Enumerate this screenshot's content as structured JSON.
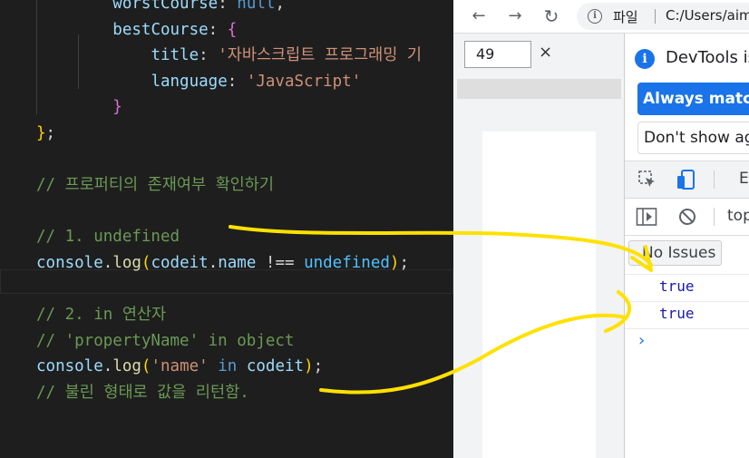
{
  "editor": {
    "lines": [
      [
        {
          "t": "        ",
          "c": "p"
        },
        {
          "t": "worstCourse",
          "c": "prop"
        },
        {
          "t": ": ",
          "c": "p"
        },
        {
          "t": "null",
          "c": "kw"
        },
        {
          "t": ",",
          "c": "p"
        }
      ],
      [
        {
          "t": "        ",
          "c": "p"
        },
        {
          "t": "bestCourse",
          "c": "prop"
        },
        {
          "t": ": ",
          "c": "p"
        },
        {
          "t": "{",
          "c": "bp"
        }
      ],
      [
        {
          "t": "            ",
          "c": "p"
        },
        {
          "t": "title",
          "c": "prop"
        },
        {
          "t": ": ",
          "c": "p"
        },
        {
          "t": "'자바스크립트 프로그래밍 기",
          "c": "str"
        }
      ],
      [
        {
          "t": "            ",
          "c": "p"
        },
        {
          "t": "language",
          "c": "prop"
        },
        {
          "t": ": ",
          "c": "p"
        },
        {
          "t": "'JavaScript'",
          "c": "str"
        }
      ],
      [
        {
          "t": "        ",
          "c": "p"
        },
        {
          "t": "}",
          "c": "bp"
        }
      ],
      [
        {
          "t": "}",
          "c": "by"
        },
        {
          "t": ";",
          "c": "p"
        }
      ],
      [],
      [
        {
          "t": "// 프로퍼티의 존재여부 확인하기",
          "c": "cm"
        }
      ],
      [],
      [
        {
          "t": "// 1. undefined",
          "c": "cm"
        }
      ],
      [
        {
          "t": "console",
          "c": "prop"
        },
        {
          "t": ".",
          "c": "p"
        },
        {
          "t": "log",
          "c": "fn"
        },
        {
          "t": "(",
          "c": "by"
        },
        {
          "t": "codeit",
          "c": "prop"
        },
        {
          "t": ".",
          "c": "p"
        },
        {
          "t": "name",
          "c": "prop"
        },
        {
          "t": " !== ",
          "c": "p"
        },
        {
          "t": "undefined",
          "c": "obj"
        },
        {
          "t": ")",
          "c": "by"
        },
        {
          "t": ";",
          "c": "p"
        }
      ],
      [],
      [
        {
          "t": "// 2. in 연산자",
          "c": "cm"
        }
      ],
      [
        {
          "t": "// 'propertyName' in object",
          "c": "cm"
        }
      ],
      [
        {
          "t": "console",
          "c": "prop"
        },
        {
          "t": ".",
          "c": "p"
        },
        {
          "t": "log",
          "c": "fn"
        },
        {
          "t": "(",
          "c": "by"
        },
        {
          "t": "'name'",
          "c": "str"
        },
        {
          "t": " in ",
          "c": "kw"
        },
        {
          "t": "codeit",
          "c": "prop"
        },
        {
          "t": ")",
          "c": "by"
        },
        {
          "t": ";",
          "c": "p"
        }
      ],
      [
        {
          "t": "// 불린 형태로 값을 리턴함.",
          "c": "cm"
        }
      ]
    ]
  },
  "browser": {
    "nav": {
      "back_icon": "arrow-left-icon",
      "forward_icon": "arrow-right-icon",
      "reload_icon": "reload-icon"
    },
    "address": {
      "label": "파일",
      "url": "C:/Users/aim"
    },
    "device_toolbar": {
      "width_value": "49",
      "close_glyph": "×"
    }
  },
  "devtools": {
    "notification": "DevTools is",
    "always_match_button": "Always match",
    "dont_show_button": "Don't show ag",
    "tab_elements_partial": "El",
    "context_selector": "top",
    "issues_badge": "No Issues",
    "console_output": [
      "true",
      "true"
    ],
    "prompt_glyph": "›"
  },
  "colors": {
    "accent": "#1a73e8",
    "annotation": "#ffe100",
    "editor_bg": "#1e1e1e"
  }
}
